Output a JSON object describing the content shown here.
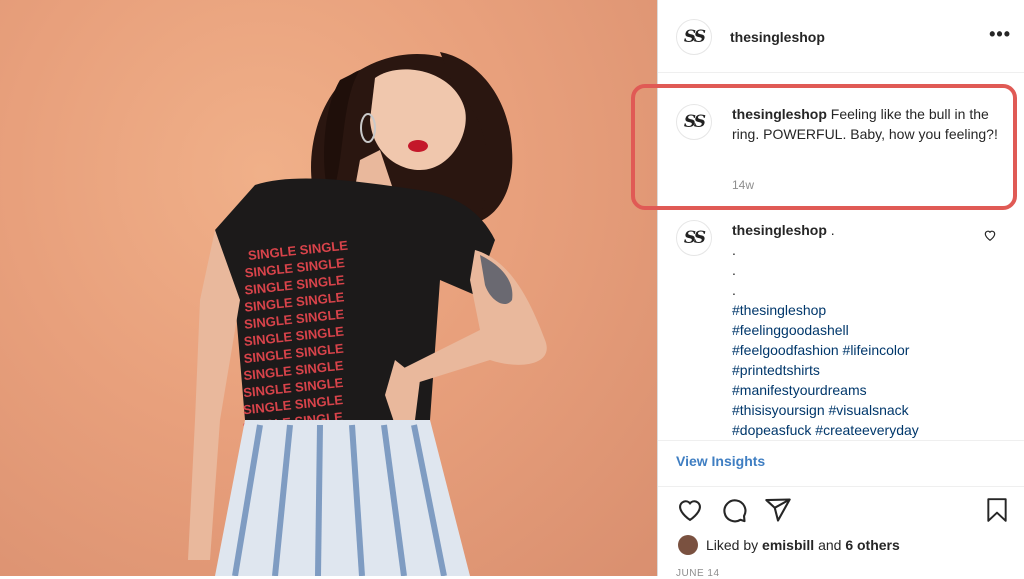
{
  "post": {
    "username": "thesingleshop",
    "avatar_text": "SS",
    "more_icon": "•••",
    "caption_user": "thesingleshop",
    "caption_text": " Feeling like the bull in the ring. POWERFUL. Baby, how you feeling?!",
    "caption_time": "14w",
    "comment_user": "thesingleshop",
    "comment_text": " .",
    "comment_dots": [
      ".",
      ".",
      "."
    ],
    "hashtag_lines": [
      "#thesingleshop",
      "#feelinggoodashell",
      "#feelgoodfashion #lifeincolor",
      "#printedtshirts",
      "#manifestyourdreams",
      "#thisisyoursign #visualsnack",
      "#dopeasfuck #createeveryday"
    ],
    "view_insights": "View Insights",
    "liked_prefix": "Liked by ",
    "liked_user": "emisbill",
    "liked_mid": " and ",
    "liked_others": "6 others",
    "date": "JUNE 14",
    "shirt_text": "SINGLE SINGLE"
  },
  "icons": [
    "like-icon",
    "comment-icon",
    "share-icon",
    "save-icon",
    "comment-like-icon",
    "more-options-icon"
  ],
  "colors": {
    "highlight": "#e05a55",
    "link": "#00376b",
    "insights": "#3f7ec2",
    "background_photo": "#e8a07c"
  }
}
